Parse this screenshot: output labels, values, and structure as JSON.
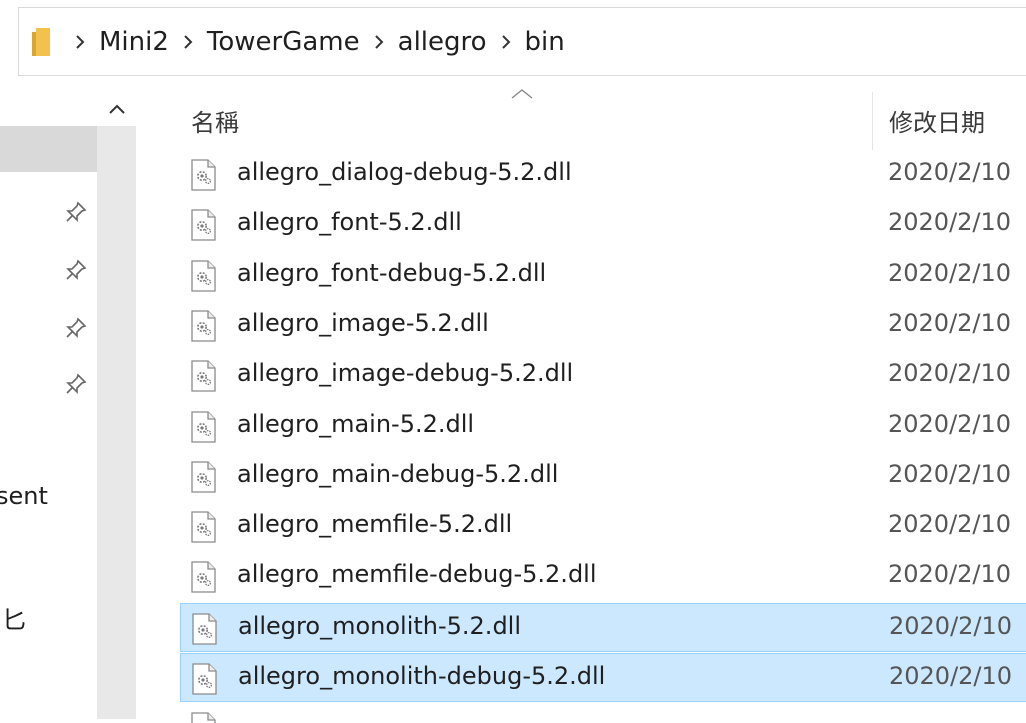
{
  "breadcrumb": [
    "Mini2",
    "TowerGame",
    "allegro",
    "bin"
  ],
  "nav": {
    "items": [
      {
        "label": "",
        "pinned": false,
        "selected": true
      },
      {
        "label": "",
        "pinned": true
      },
      {
        "label": "",
        "pinned": true
      },
      {
        "label": "",
        "pinned": true
      },
      {
        "label": "",
        "pinned": true
      },
      {
        "label": "sent"
      },
      {
        "label": "匕"
      }
    ]
  },
  "columns": {
    "name": "名稱",
    "date_modified": "修改日期"
  },
  "files": [
    {
      "name": "allegro_dialog-debug-5.2.dll",
      "date": "2020/2/10",
      "selected": false
    },
    {
      "name": "allegro_font-5.2.dll",
      "date": "2020/2/10",
      "selected": false
    },
    {
      "name": "allegro_font-debug-5.2.dll",
      "date": "2020/2/10",
      "selected": false
    },
    {
      "name": "allegro_image-5.2.dll",
      "date": "2020/2/10",
      "selected": false
    },
    {
      "name": "allegro_image-debug-5.2.dll",
      "date": "2020/2/10",
      "selected": false
    },
    {
      "name": "allegro_main-5.2.dll",
      "date": "2020/2/10",
      "selected": false
    },
    {
      "name": "allegro_main-debug-5.2.dll",
      "date": "2020/2/10",
      "selected": false
    },
    {
      "name": "allegro_memfile-5.2.dll",
      "date": "2020/2/10",
      "selected": false
    },
    {
      "name": "allegro_memfile-debug-5.2.dll",
      "date": "2020/2/10",
      "selected": false
    },
    {
      "name": "allegro_monolith-5.2.dll",
      "date": "2020/2/10",
      "selected": true
    },
    {
      "name": "allegro_monolith-debug-5.2.dll",
      "date": "2020/2/10",
      "selected": true
    }
  ],
  "colors": {
    "selection_bg": "#cce8ff",
    "selection_border": "#99d1ff",
    "folder": "#f2c14e"
  },
  "icons": {
    "folder": "folder-icon",
    "file": "dll-file-icon",
    "pin": "pin-icon",
    "separator": "chevron-right-icon",
    "sort": "sort-ascending-icon",
    "scroll_up": "chevron-up-icon"
  }
}
